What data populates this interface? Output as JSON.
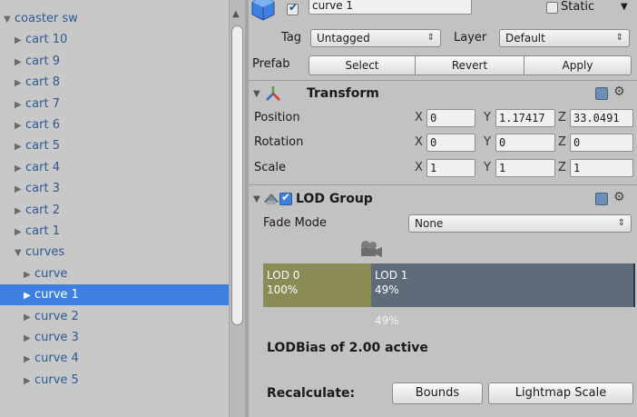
{
  "hierarchy": {
    "items": [
      {
        "label": "coaster sw",
        "depth": 0,
        "expanded": true,
        "selected": false
      },
      {
        "label": "cart 10",
        "depth": 1,
        "expanded": false,
        "selected": false
      },
      {
        "label": "cart 9",
        "depth": 1,
        "expanded": false,
        "selected": false
      },
      {
        "label": "cart 8",
        "depth": 1,
        "expanded": false,
        "selected": false
      },
      {
        "label": "cart 7",
        "depth": 1,
        "expanded": false,
        "selected": false
      },
      {
        "label": "cart 6",
        "depth": 1,
        "expanded": false,
        "selected": false
      },
      {
        "label": "cart 5",
        "depth": 1,
        "expanded": false,
        "selected": false
      },
      {
        "label": "cart 4",
        "depth": 1,
        "expanded": false,
        "selected": false
      },
      {
        "label": "cart 3",
        "depth": 1,
        "expanded": false,
        "selected": false
      },
      {
        "label": "cart 2",
        "depth": 1,
        "expanded": false,
        "selected": false
      },
      {
        "label": "cart 1",
        "depth": 1,
        "expanded": false,
        "selected": false
      },
      {
        "label": "curves",
        "depth": 1,
        "expanded": true,
        "selected": false
      },
      {
        "label": "curve",
        "depth": 2,
        "expanded": false,
        "selected": false
      },
      {
        "label": "curve 1",
        "depth": 2,
        "expanded": false,
        "selected": true
      },
      {
        "label": "curve 2",
        "depth": 2,
        "expanded": false,
        "selected": false
      },
      {
        "label": "curve 3",
        "depth": 2,
        "expanded": false,
        "selected": false
      },
      {
        "label": "curve 4",
        "depth": 2,
        "expanded": false,
        "selected": false
      },
      {
        "label": "curve 5",
        "depth": 2,
        "expanded": false,
        "selected": false
      }
    ]
  },
  "inspector": {
    "object_name": "curve 1",
    "static_label": "Static",
    "tag_label": "Tag",
    "tag_value": "Untagged",
    "layer_label": "Layer",
    "layer_value": "Default",
    "prefab_label": "Prefab",
    "prefab_buttons": {
      "select": "Select",
      "revert": "Revert",
      "apply": "Apply"
    },
    "transform": {
      "title": "Transform",
      "position_label": "Position",
      "rotation_label": "Rotation",
      "scale_label": "Scale",
      "axis_x": "X",
      "axis_y": "Y",
      "axis_z": "Z",
      "position": {
        "x": "0",
        "y": "1.17417",
        "z": "33.0491"
      },
      "rotation": {
        "x": "0",
        "y": "0",
        "z": "0"
      },
      "scale": {
        "x": "1",
        "y": "1",
        "z": "1"
      }
    },
    "lod_group": {
      "title": "LOD Group",
      "fade_mode_label": "Fade Mode",
      "fade_mode_value": "None",
      "lod0_name": "LOD 0",
      "lod0_percent": "100%",
      "lod1_name": "LOD 1",
      "lod1_percent": "49%",
      "lod0_fraction": 0.29,
      "current_marker": "49%",
      "bias_text": "LODBias of 2.00 active",
      "recalculate_label": "Recalculate:",
      "bounds_button": "Bounds",
      "lightmap_button": "Lightmap Scale"
    }
  },
  "colors": {
    "selection": "#3d80df",
    "lod0": "#8a8b55",
    "lod1": "#5e6b78"
  }
}
